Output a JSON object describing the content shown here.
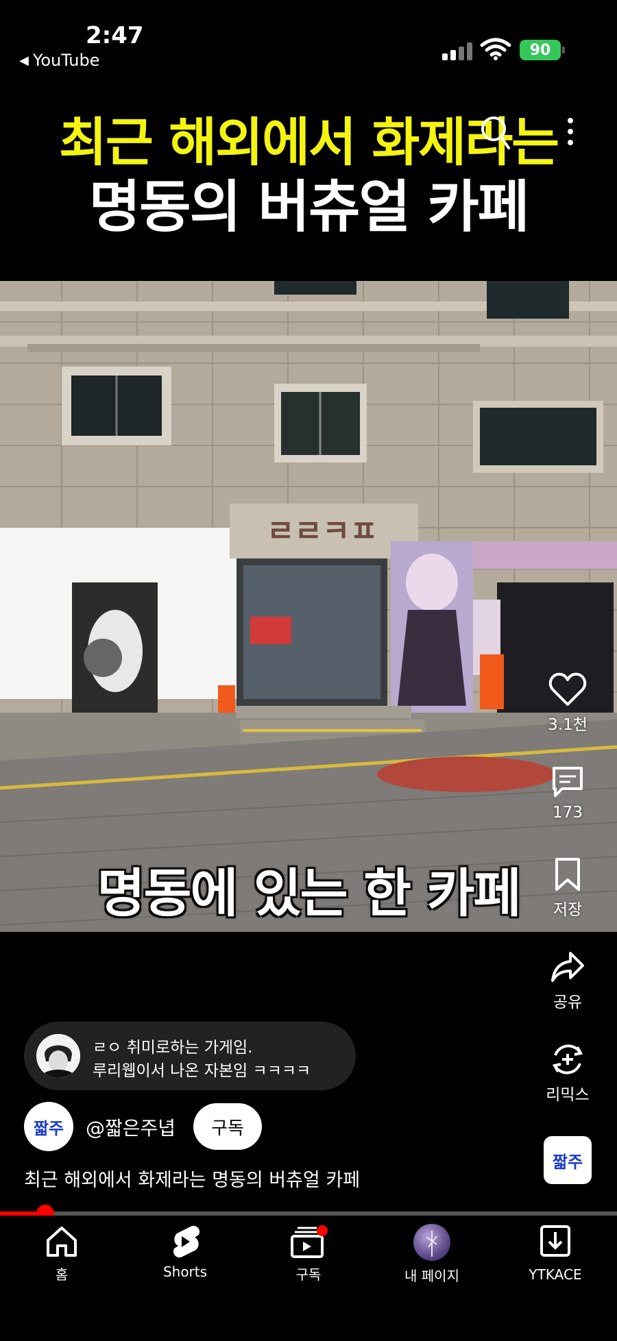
{
  "status_bar": {
    "time": "2:47",
    "back_app": "YouTube",
    "battery": "90"
  },
  "video": {
    "title_line_1": "최근 해외에서 화제라는",
    "title_line_2": "명동의 버츄얼 카페",
    "caption": "명동에 있는 한 카페",
    "progress": 0.073
  },
  "actions": {
    "like_count": "3.1천",
    "comment_count": "173",
    "save_label": "저장",
    "share_label": "공유",
    "remix_label": "리믹스"
  },
  "comment_preview": {
    "line1": "ㄹㅇ 취미로하는 가게임.",
    "line2": "루리웹이서 나온 자본임 ㅋㅋㅋㅋ"
  },
  "channel": {
    "avatar_text": "짧주",
    "handle": "@짧은주녑",
    "subscribe_label": "구독",
    "description": "최근 해외에서 화제라는 명동의 버츄얼 카페"
  },
  "sound": {
    "thumb_text": "짧주"
  },
  "nav": {
    "home": "홈",
    "shorts": "Shorts",
    "subscriptions": "구독",
    "my_page": "내 페이지",
    "download": "YTKACE"
  },
  "colors": {
    "title_yellow": "#f4f411",
    "accent_red": "#ff0000",
    "battery_green": "#34c759"
  }
}
